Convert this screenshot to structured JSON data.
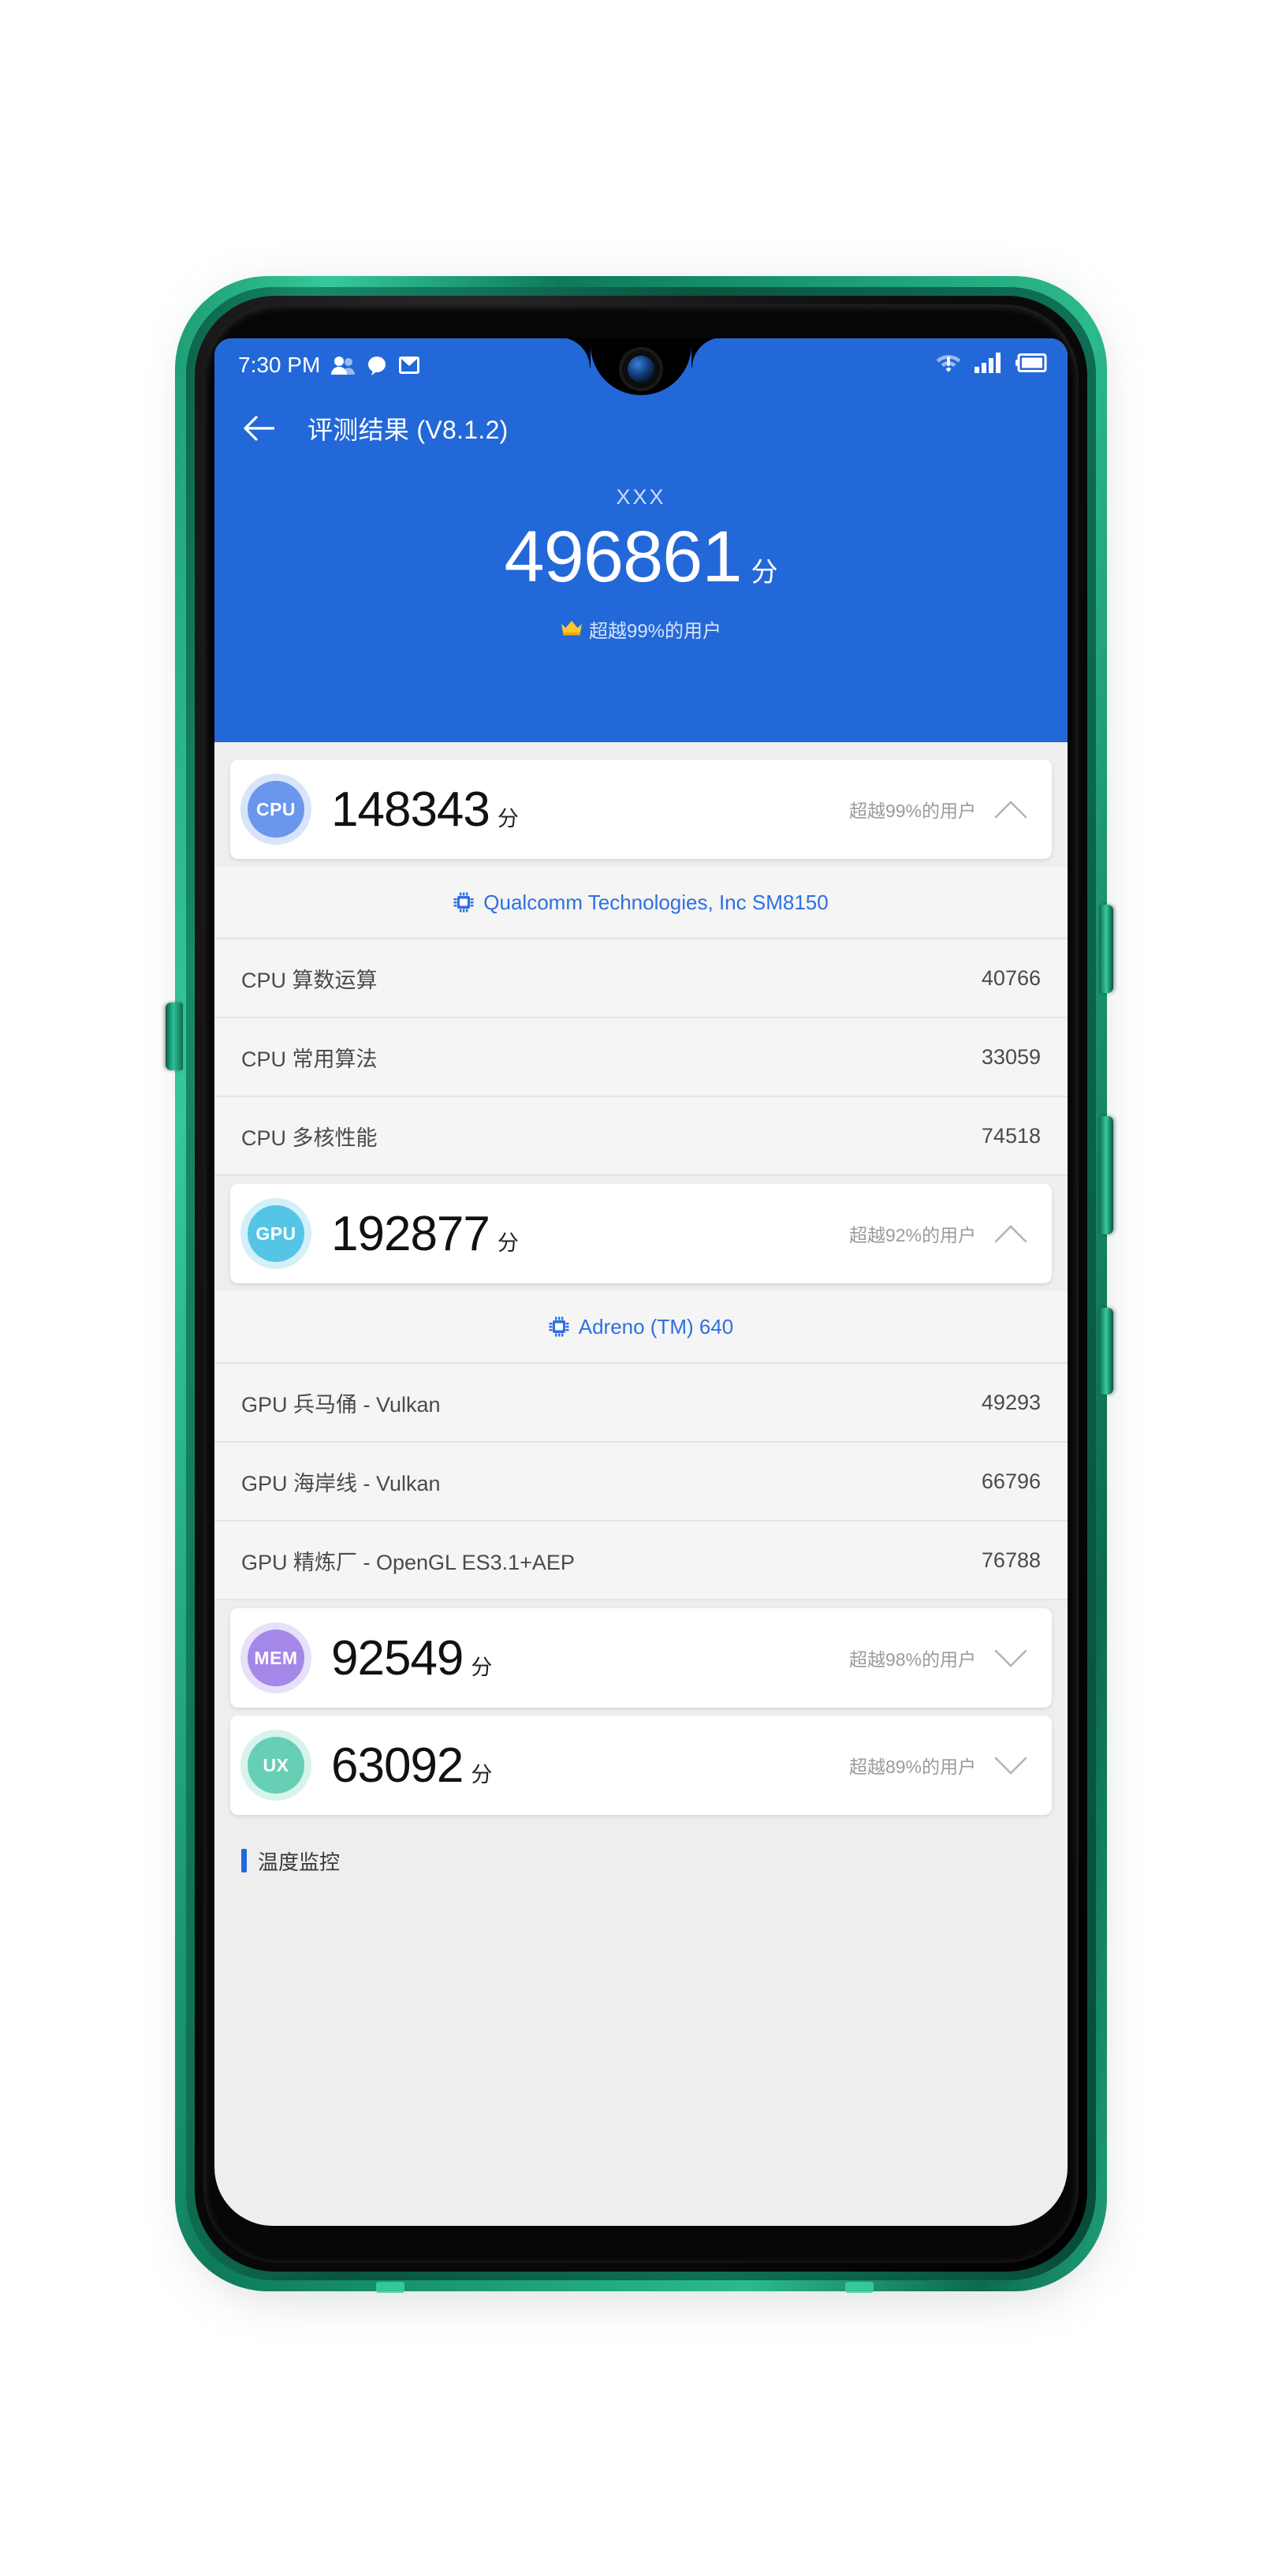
{
  "status_bar": {
    "time": "7:30 PM",
    "left_icons": [
      "people-icon",
      "chat-icon",
      "mail-icon"
    ],
    "right_icons": [
      "wifi-alert-icon",
      "signal-icon",
      "battery-icon"
    ]
  },
  "app_bar": {
    "back_icon": "back-arrow-icon",
    "title": "评测结果 (V8.1.2)"
  },
  "hero": {
    "device_name": "XXX",
    "total_score": "496861",
    "unit": "分",
    "rank_icon": "crown-icon",
    "rank_text": "超越99%的用户"
  },
  "sections": [
    {
      "key": "cpu",
      "badge": "CPU",
      "score": "148343",
      "unit": "分",
      "rank_text": "超越99%的用户",
      "chevron": "chevron-up-icon",
      "expanded": true,
      "chip_icon": "cpu-chip-icon",
      "chip_name": "Qualcomm Technologies, Inc SM8150",
      "items": [
        {
          "label": "CPU 算数运算",
          "value": "40766"
        },
        {
          "label": "CPU 常用算法",
          "value": "33059"
        },
        {
          "label": "CPU 多核性能",
          "value": "74518"
        }
      ]
    },
    {
      "key": "gpu",
      "badge": "GPU",
      "score": "192877",
      "unit": "分",
      "rank_text": "超越92%的用户",
      "chevron": "chevron-up-icon",
      "expanded": true,
      "chip_icon": "gpu-chip-icon",
      "chip_name": "Adreno (TM) 640",
      "items": [
        {
          "label": "GPU 兵马俑 - Vulkan",
          "value": "49293"
        },
        {
          "label": "GPU 海岸线 - Vulkan",
          "value": "66796"
        },
        {
          "label": "GPU 精炼厂 - OpenGL ES3.1+AEP",
          "value": "76788"
        }
      ]
    },
    {
      "key": "mem",
      "badge": "MEM",
      "score": "92549",
      "unit": "分",
      "rank_text": "超越98%的用户",
      "chevron": "chevron-down-icon",
      "expanded": false,
      "items": []
    },
    {
      "key": "ux",
      "badge": "UX",
      "score": "63092",
      "unit": "分",
      "rank_text": "超越89%的用户",
      "chevron": "chevron-down-icon",
      "expanded": false,
      "items": []
    }
  ],
  "footer": {
    "label": "温度监控"
  },
  "colors": {
    "header_blue": "#2368D8",
    "page_bg": "#EEEEEE",
    "cpu": "#6A96EC",
    "gpu": "#55C5E6",
    "mem": "#A488E8",
    "ux": "#66CFB5",
    "link_blue": "#2F6FE0",
    "phone_frame_green": "#1d9b73"
  }
}
